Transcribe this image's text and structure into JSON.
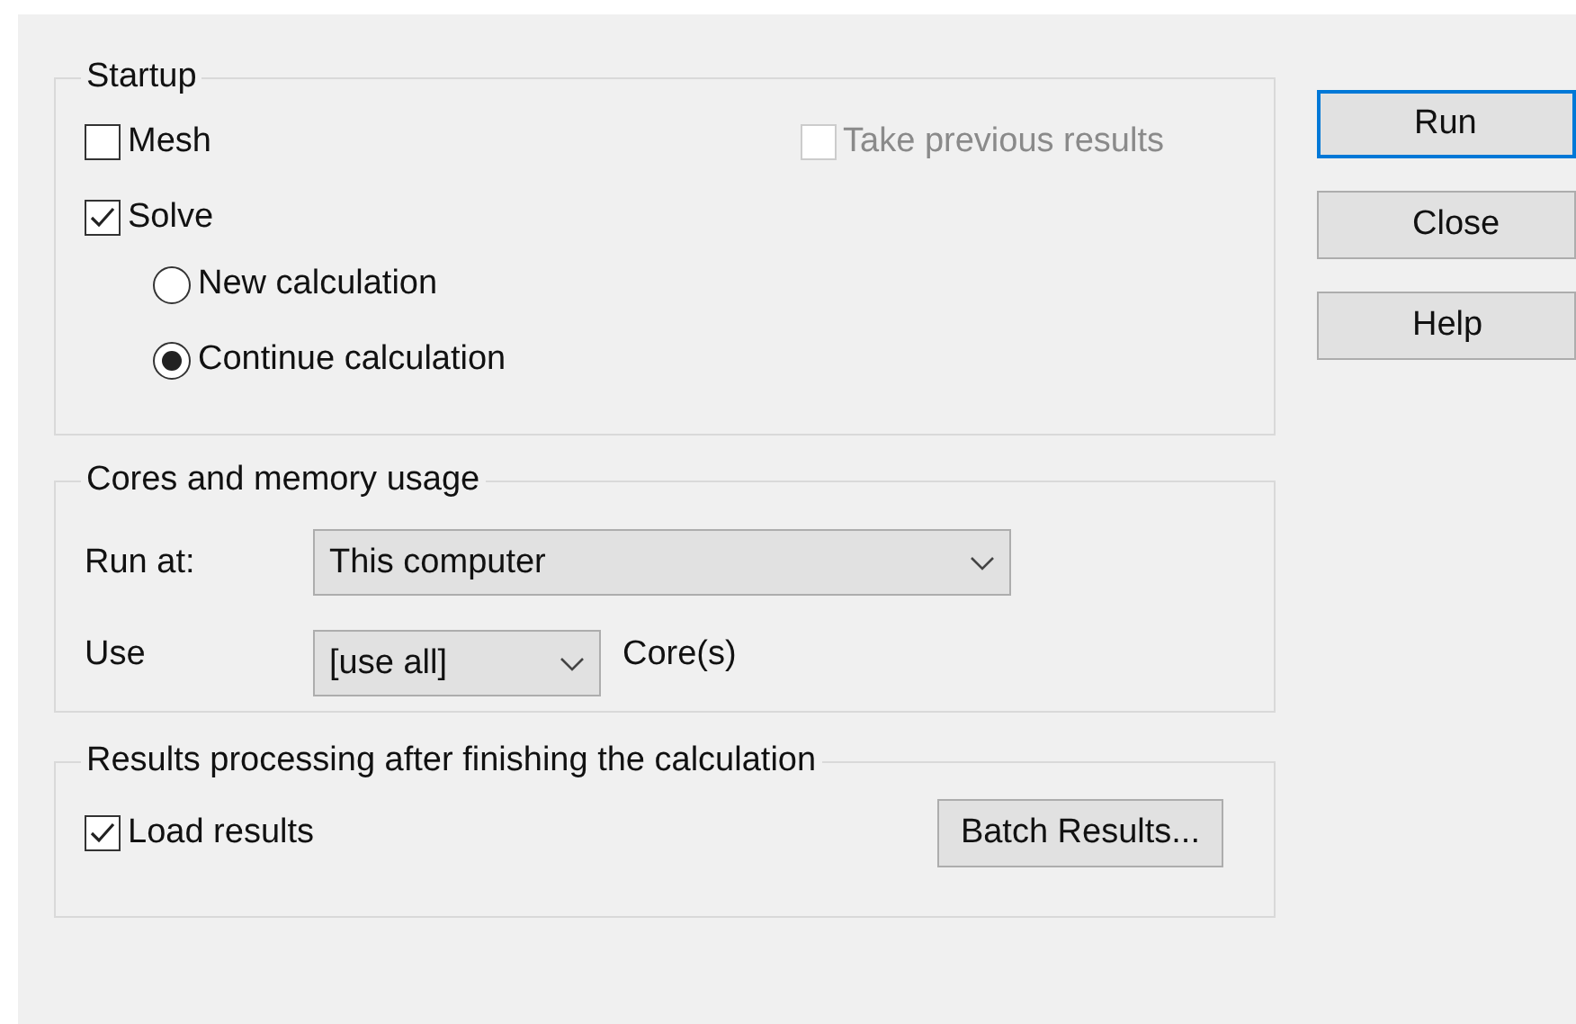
{
  "startup": {
    "title": "Startup",
    "mesh": {
      "label": "Mesh",
      "checked": false,
      "disabled": false
    },
    "take_previous": {
      "label": "Take previous results",
      "checked": false,
      "disabled": true
    },
    "solve": {
      "label": "Solve",
      "checked": true,
      "disabled": false
    },
    "radios": [
      {
        "label": "New calculation",
        "selected": false
      },
      {
        "label": "Continue calculation",
        "selected": true
      }
    ]
  },
  "cores": {
    "title": "Cores and memory usage",
    "run_at": {
      "label": "Run at:",
      "value": "This computer"
    },
    "use": {
      "label": "Use",
      "value": "[use all]",
      "suffix": "Core(s)"
    }
  },
  "results": {
    "title": "Results processing after finishing the calculation",
    "load": {
      "label": "Load results",
      "checked": true,
      "disabled": false
    },
    "batch_button": "Batch Results..."
  },
  "buttons": [
    {
      "label": "Run",
      "default": true
    },
    {
      "label": "Close",
      "default": false
    },
    {
      "label": "Help",
      "default": false
    }
  ]
}
